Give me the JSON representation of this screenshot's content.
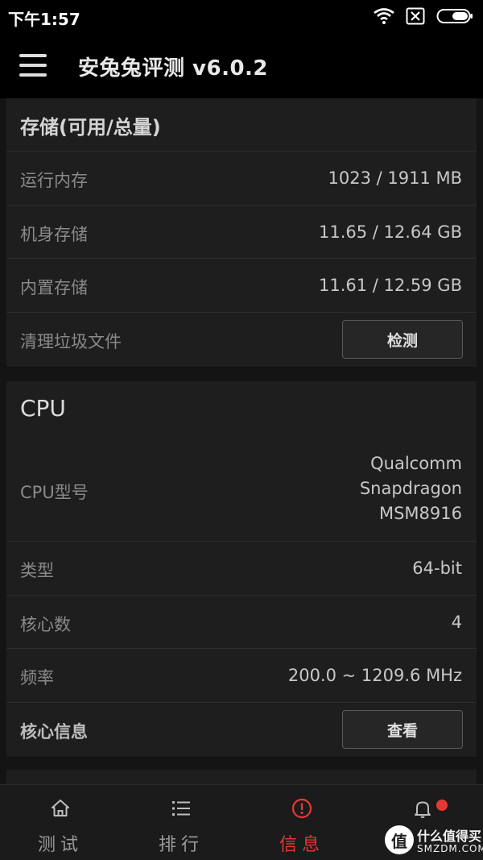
{
  "status_bar": {
    "time": "下午1:57",
    "icons": [
      "wifi-icon",
      "sim-x-icon",
      "battery-icon"
    ]
  },
  "app_bar": {
    "title": "安兔兔评测 v6.0.2",
    "menu_icon": "hamburger-menu-icon"
  },
  "storage_card": {
    "header": "存储(可用/总量)",
    "rows": [
      {
        "label": "运行内存",
        "value": "1023 / 1911 MB"
      },
      {
        "label": "机身存储",
        "value": "11.65 / 12.64 GB"
      },
      {
        "label": "内置存储",
        "value": "11.61 / 12.59 GB"
      }
    ],
    "clean": {
      "label": "清理垃圾文件",
      "button": "检测"
    }
  },
  "cpu_card": {
    "header": "CPU",
    "model": {
      "label": "CPU型号",
      "value_lines": [
        "Qualcomm",
        "Snapdragon",
        "MSM8916"
      ]
    },
    "rows": [
      {
        "label": "类型",
        "value": "64-bit"
      },
      {
        "label": "核心数",
        "value": "4"
      },
      {
        "label": "频率",
        "value": "200.0 ~ 1209.6 MHz"
      }
    ],
    "core_info": {
      "label": "核心信息",
      "button": "查看"
    }
  },
  "bottom_nav": {
    "items": [
      {
        "label": "测试",
        "icon": "home-icon",
        "active": false
      },
      {
        "label": "排行",
        "icon": "list-icon",
        "active": false
      },
      {
        "label": "信息",
        "icon": "alert-circle-icon",
        "active": true
      },
      {
        "label": "",
        "icon": "bell-icon",
        "active": false,
        "badge": true
      }
    ]
  },
  "watermark": {
    "title": "什么值得买",
    "sub": "SMZDM.COM",
    "logo_char": "值"
  },
  "colors": {
    "accent": "#e53935",
    "background": "#141414",
    "card": "#1e1e1e",
    "bar": "#000000"
  }
}
